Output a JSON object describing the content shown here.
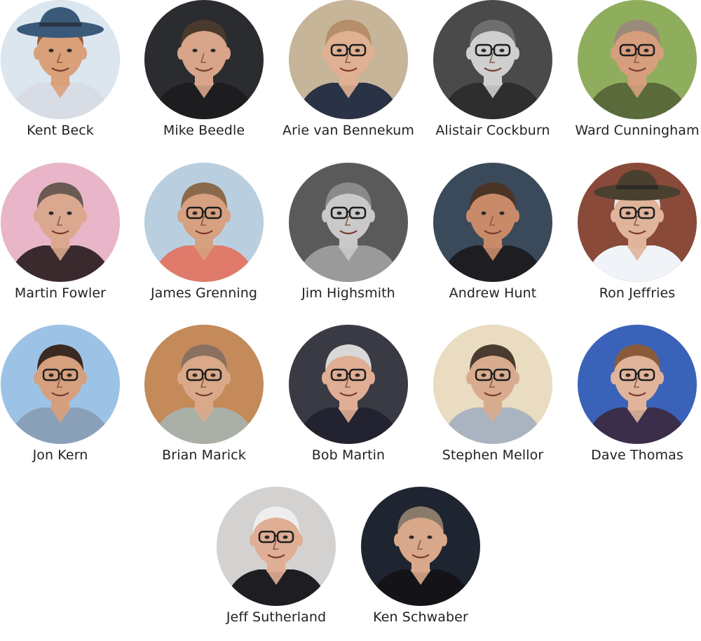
{
  "people": [
    {
      "name": "Kent Beck",
      "bg": "#dbe6ef",
      "skin": "#d9a07a",
      "hair": "#8a5a3c",
      "shirt": "#d8dde5",
      "hat": "#3b5a7a",
      "glasses": false
    },
    {
      "name": "Mike Beedle",
      "bg": "#2b2c30",
      "skin": "#d8a58a",
      "hair": "#4a3a2e",
      "shirt": "#1d1d1f",
      "hat": "",
      "glasses": false
    },
    {
      "name": "Arie van Bennekum",
      "bg": "#c7b59a",
      "skin": "#e0b093",
      "hair": "#b58f6a",
      "shirt": "#2a3246",
      "hat": "",
      "glasses": true
    },
    {
      "name": "Alistair Cockburn",
      "bg": "#4a4a4a",
      "skin": "#cfcfcf",
      "hair": "#6e6e6e",
      "shirt": "#2e2e2e",
      "hat": "",
      "glasses": true
    },
    {
      "name": "Ward Cunningham",
      "bg": "#8fae5d",
      "skin": "#d69e7c",
      "hair": "#9a8a7a",
      "shirt": "#5a6a3a",
      "hat": "",
      "glasses": true
    },
    {
      "name": "Martin Fowler",
      "bg": "#e8b6c8",
      "skin": "#d9a88e",
      "hair": "#6a5a52",
      "shirt": "#3a2a2e",
      "hat": "",
      "glasses": false
    },
    {
      "name": "James Grenning",
      "bg": "#b9cfe0",
      "skin": "#d7a080",
      "hair": "#8a6a4a",
      "shirt": "#e07a6a",
      "hat": "",
      "glasses": true
    },
    {
      "name": "Jim Highsmith",
      "bg": "#5a5a5a",
      "skin": "#c9c9c9",
      "hair": "#8a8a8a",
      "shirt": "#9a9a9a",
      "hat": "",
      "glasses": true
    },
    {
      "name": "Andrew Hunt",
      "bg": "#3a4a5a",
      "skin": "#c98a6a",
      "hair": "#4a3426",
      "shirt": "#1e1e22",
      "hat": "",
      "glasses": false
    },
    {
      "name": "Ron Jeffries",
      "bg": "#8a4a3a",
      "skin": "#e0b49a",
      "hair": "#e8e8e8",
      "shirt": "#f0f4f8",
      "hat": "#4a4030",
      "glasses": true
    },
    {
      "name": "Jon Kern",
      "bg": "#9cc3e6",
      "skin": "#d6a07e",
      "hair": "#3a2a22",
      "shirt": "#8aa0b8",
      "hat": "",
      "glasses": true
    },
    {
      "name": "Brian Marick",
      "bg": "#c48a5a",
      "skin": "#d9a98a",
      "hair": "#8a7060",
      "shirt": "#aab0a8",
      "hat": "",
      "glasses": true
    },
    {
      "name": "Bob Martin",
      "bg": "#3a3a44",
      "skin": "#e0ae94",
      "hair": "#d8d8d8",
      "shirt": "#222230",
      "hat": "",
      "glasses": true
    },
    {
      "name": "Stephen Mellor",
      "bg": "#e9dcc0",
      "skin": "#d9ab8e",
      "hair": "#4a3a30",
      "shirt": "#aab4c0",
      "hat": "",
      "glasses": true
    },
    {
      "name": "Dave Thomas",
      "bg": "#3a62b8",
      "skin": "#e0b49a",
      "hair": "#8a5a3a",
      "shirt": "#3a2e4a",
      "hat": "",
      "glasses": true
    },
    {
      "name": "Jeff Sutherland",
      "bg": "#d4d2d0",
      "skin": "#e0ae94",
      "hair": "#eeeeee",
      "shirt": "#1e1e22",
      "hat": "",
      "glasses": true
    },
    {
      "name": "Ken Schwaber",
      "bg": "#1e2430",
      "skin": "#d9a88a",
      "hair": "#8a7a6a",
      "shirt": "#141418",
      "hat": "",
      "glasses": false
    }
  ]
}
